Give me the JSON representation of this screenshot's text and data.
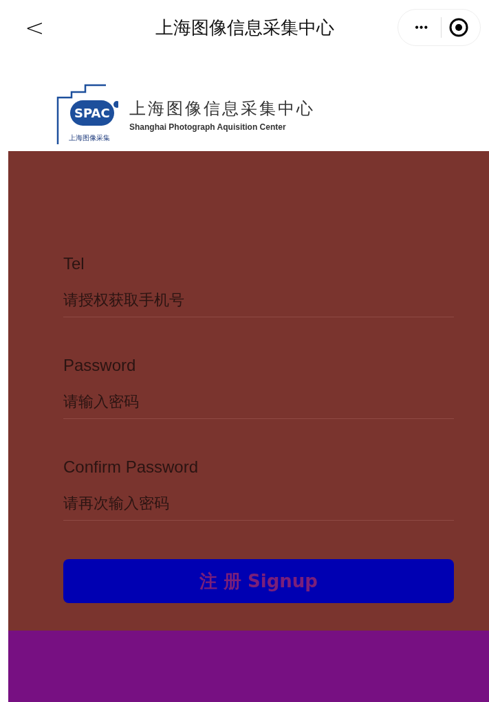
{
  "nav_bar": {
    "back": "<",
    "title": "上海图像信息采集中心",
    "more": "•••"
  },
  "logo": {
    "initials": "SPAC",
    "name_cn": "上海图像信息采集中心",
    "name_en": "Shanghai Photograph Aquisition Center",
    "caption": "上海图像采集"
  },
  "fields": [
    {
      "label": "Tel",
      "placeholder": "请授权获取手机号"
    },
    {
      "label": "Password",
      "placeholder": "请输入密码"
    },
    {
      "label": "Confirm Password",
      "placeholder": "请再次输入密码"
    }
  ],
  "signup_button": "注 册 Signup"
}
